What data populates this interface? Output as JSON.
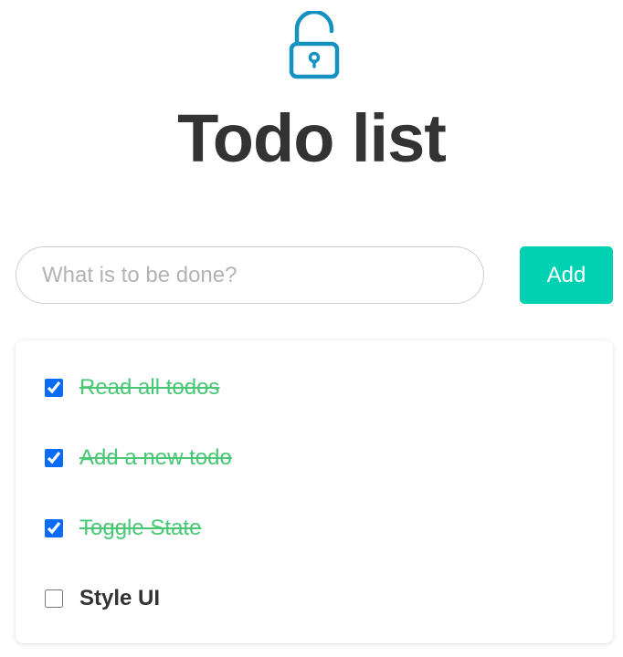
{
  "header": {
    "icon": "unlocked-padlock-icon",
    "icon_color": "#1592c0",
    "title": "Todo list"
  },
  "new_todo": {
    "placeholder": "What is to be done?",
    "value": "",
    "add_label": "Add",
    "add_color": "#00d1b2"
  },
  "todos": [
    {
      "label": "Read all todos",
      "done": true
    },
    {
      "label": "Add a new todo",
      "done": true
    },
    {
      "label": "Toggle State",
      "done": true
    },
    {
      "label": "Style UI",
      "done": false
    }
  ],
  "colors": {
    "done_text": "#48c774",
    "pending_text": "#333333",
    "checkbox_accent": "#0a6cf5"
  }
}
